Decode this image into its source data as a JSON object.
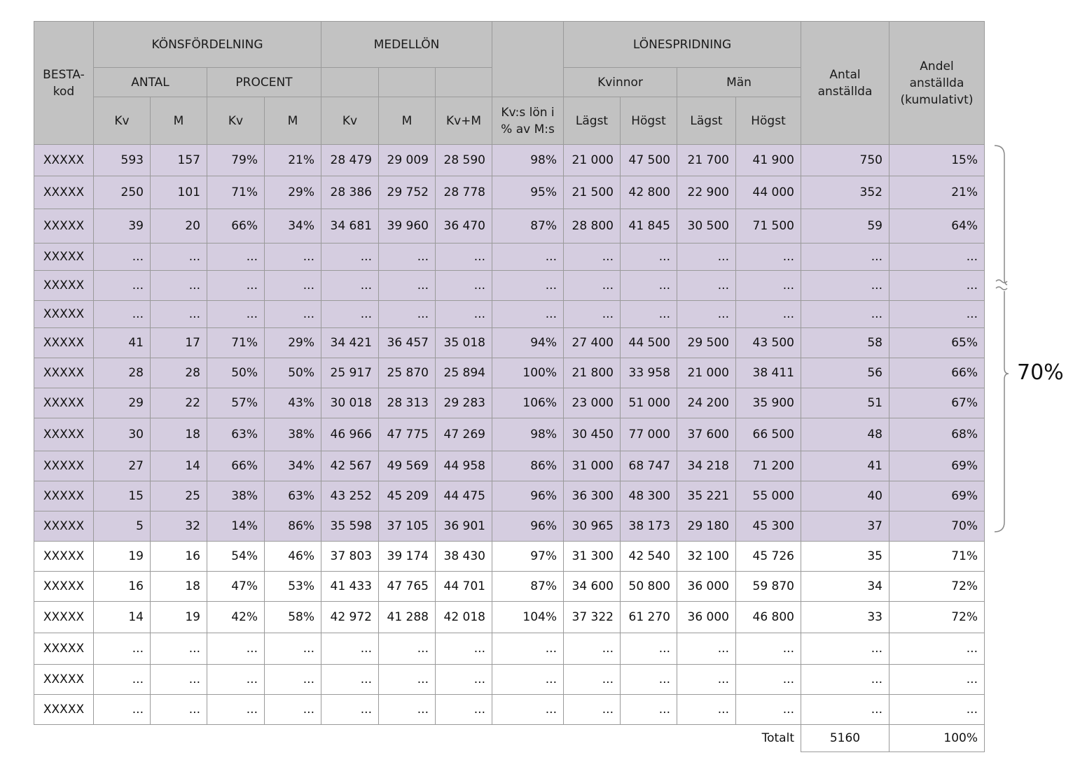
{
  "headers": {
    "besta_kod": "BESTA-kod",
    "konsfordelning": "KÖNSFÖRDELNING",
    "medellon": "MEDELLÖN",
    "lonespridning": "LÖNESPRIDNING",
    "antal_anstallda": "Antal anställda",
    "andel_anstallda": "Andel anställda (kumulativt)",
    "antal": "ANTAL",
    "procent": "PROCENT",
    "kvinnor": "Kvinnor",
    "man": "Män",
    "kv": "Kv",
    "m": "M",
    "kv_m": "Kv+M",
    "kv_lon_pct": "Kv:s lön i % av M:s",
    "lagst": "Lägst",
    "hogst": "Högst"
  },
  "rows": [
    {
      "highlight": true,
      "cells": [
        "XXXXX",
        "593",
        "157",
        "79%",
        "21%",
        "28 479",
        "29 009",
        "28 590",
        "98%",
        "21 000",
        "47 500",
        "21 700",
        "41 900",
        "750",
        "15%"
      ]
    },
    {
      "highlight": true,
      "cells": [
        "XXXXX",
        "250",
        "101",
        "71%",
        "29%",
        "28 386",
        "29 752",
        "28 778",
        "95%",
        "21 500",
        "42 800",
        "22 900",
        "44 000",
        "352",
        "21%"
      ]
    },
    {
      "highlight": true,
      "cells": [
        "XXXXX",
        "39",
        "20",
        "66%",
        "34%",
        "34 681",
        "39 960",
        "36 470",
        "87%",
        "28 800",
        "41 845",
        "30 500",
        "71 500",
        "59",
        "64%"
      ]
    },
    {
      "highlight": true,
      "cells": [
        "XXXXX",
        "...",
        "...",
        "...",
        "...",
        "...",
        "...",
        "...",
        "...",
        "...",
        "...",
        "...",
        "...",
        "...",
        "..."
      ]
    },
    {
      "highlight": true,
      "cells": [
        "XXXXX",
        "...",
        "...",
        "...",
        "...",
        "...",
        "...",
        "...",
        "...",
        "...",
        "...",
        "...",
        "...",
        "...",
        "..."
      ]
    },
    {
      "highlight": true,
      "cells": [
        "XXXXX",
        "...",
        "...",
        "...",
        "...",
        "...",
        "...",
        "...",
        "...",
        "...",
        "...",
        "...",
        "...",
        "...",
        "..."
      ]
    },
    {
      "highlight": true,
      "cells": [
        "XXXXX",
        "41",
        "17",
        "71%",
        "29%",
        "34 421",
        "36 457",
        "35 018",
        "94%",
        "27 400",
        "44 500",
        "29 500",
        "43 500",
        "58",
        "65%"
      ]
    },
    {
      "highlight": true,
      "cells": [
        "XXXXX",
        "28",
        "28",
        "50%",
        "50%",
        "25 917",
        "25 870",
        "25 894",
        "100%",
        "21 800",
        "33 958",
        "21 000",
        "38 411",
        "56",
        "66%"
      ]
    },
    {
      "highlight": true,
      "cells": [
        "XXXXX",
        "29",
        "22",
        "57%",
        "43%",
        "30 018",
        "28 313",
        "29 283",
        "106%",
        "23 000",
        "51 000",
        "24 200",
        "35 900",
        "51",
        "67%"
      ]
    },
    {
      "highlight": true,
      "cells": [
        "XXXXX",
        "30",
        "18",
        "63%",
        "38%",
        "46 966",
        "47 775",
        "47 269",
        "98%",
        "30 450",
        "77 000",
        "37 600",
        "66 500",
        "48",
        "68%"
      ]
    },
    {
      "highlight": true,
      "cells": [
        "XXXXX",
        "27",
        "14",
        "66%",
        "34%",
        "42 567",
        "49 569",
        "44 958",
        "86%",
        "31 000",
        "68 747",
        "34 218",
        "71 200",
        "41",
        "69%"
      ]
    },
    {
      "highlight": true,
      "cells": [
        "XXXXX",
        "15",
        "25",
        "38%",
        "63%",
        "43 252",
        "45 209",
        "44 475",
        "96%",
        "36 300",
        "48 300",
        "35 221",
        "55 000",
        "40",
        "69%"
      ]
    },
    {
      "highlight": true,
      "cells": [
        "XXXXX",
        "5",
        "32",
        "14%",
        "86%",
        "35 598",
        "37 105",
        "36 901",
        "96%",
        "30 965",
        "38 173",
        "29 180",
        "45 300",
        "37",
        "70%"
      ]
    },
    {
      "highlight": false,
      "cells": [
        "XXXXX",
        "19",
        "16",
        "54%",
        "46%",
        "37 803",
        "39 174",
        "38 430",
        "97%",
        "31 300",
        "42 540",
        "32 100",
        "45 726",
        "35",
        "71%"
      ]
    },
    {
      "highlight": false,
      "cells": [
        "XXXXX",
        "16",
        "18",
        "47%",
        "53%",
        "41 433",
        "47 765",
        "44 701",
        "87%",
        "34 600",
        "50 800",
        "36 000",
        "59 870",
        "34",
        "72%"
      ]
    },
    {
      "highlight": false,
      "cells": [
        "XXXXX",
        "14",
        "19",
        "42%",
        "58%",
        "42 972",
        "41 288",
        "42 018",
        "104%",
        "37 322",
        "61 270",
        "36 000",
        "46 800",
        "33",
        "72%"
      ]
    },
    {
      "highlight": false,
      "cells": [
        "XXXXX",
        "...",
        "...",
        "...",
        "...",
        "...",
        "...",
        "...",
        "...",
        "...",
        "...",
        "...",
        "...",
        "...",
        "..."
      ]
    },
    {
      "highlight": false,
      "cells": [
        "XXXXX",
        "...",
        "...",
        "...",
        "...",
        "...",
        "...",
        "...",
        "...",
        "...",
        "...",
        "...",
        "...",
        "...",
        "..."
      ]
    },
    {
      "highlight": false,
      "cells": [
        "XXXXX",
        "...",
        "...",
        "...",
        "...",
        "...",
        "...",
        "...",
        "...",
        "...",
        "...",
        "...",
        "...",
        "...",
        "..."
      ]
    }
  ],
  "total": {
    "label": "Totalt",
    "antal": "5160",
    "andel": "100%"
  },
  "brace_label": "70%",
  "colors": {
    "header_bg": "#c2c2c2",
    "highlight_bg": "#d5cde0",
    "border": "#9a9a9a"
  }
}
